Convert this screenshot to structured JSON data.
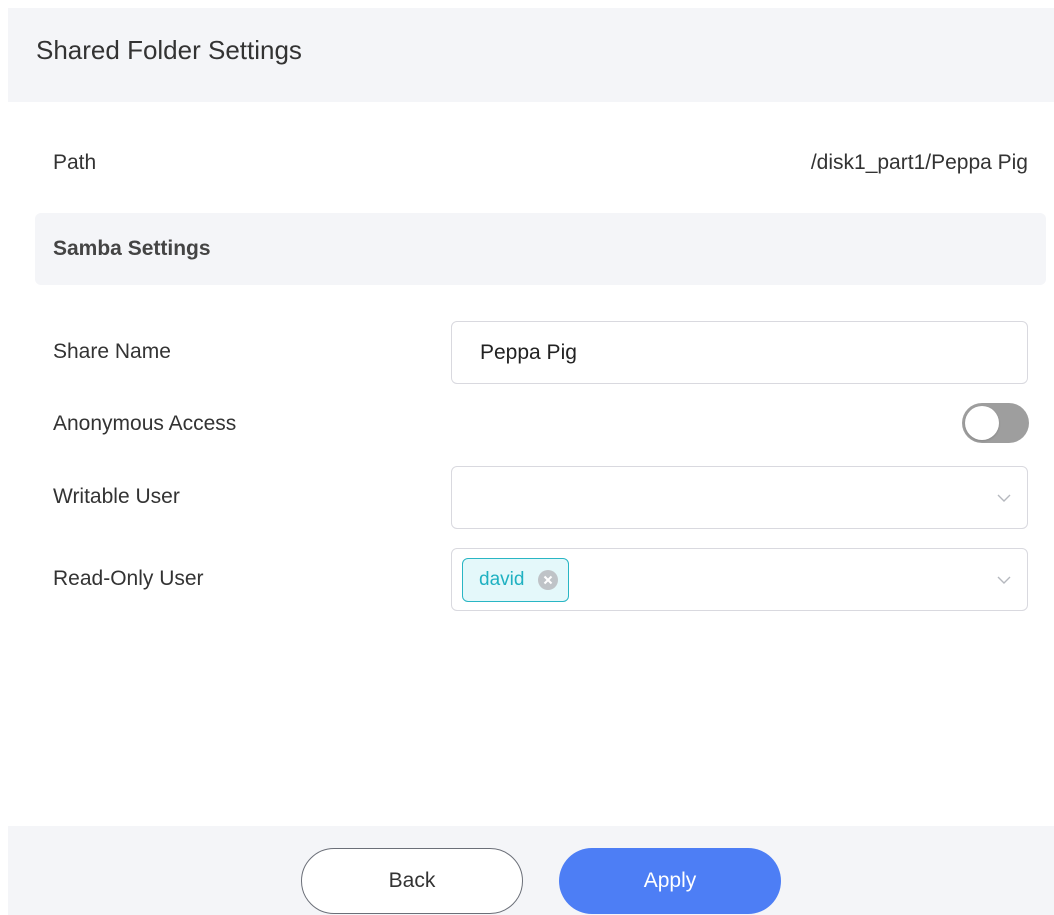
{
  "header": {
    "title": "Shared Folder Settings"
  },
  "path": {
    "label": "Path",
    "value": "/disk1_part1/Peppa Pig"
  },
  "samba": {
    "section_title": "Samba Settings",
    "share_name": {
      "label": "Share Name",
      "value": "Peppa Pig"
    },
    "anonymous_access": {
      "label": "Anonymous Access",
      "enabled": false
    },
    "writable_user": {
      "label": "Writable User",
      "selected": []
    },
    "read_only_user": {
      "label": "Read-Only User",
      "selected": [
        "david"
      ]
    }
  },
  "footer": {
    "back_label": "Back",
    "apply_label": "Apply"
  },
  "colors": {
    "primary": "#4d7ef5",
    "tag_accent": "#1fb1c1",
    "panel_bg": "#f4f5f8",
    "toggle_off": "#9e9e9e"
  },
  "icons": {
    "dropdown": "chevron-down-icon",
    "tag_remove": "close-circle-icon"
  }
}
